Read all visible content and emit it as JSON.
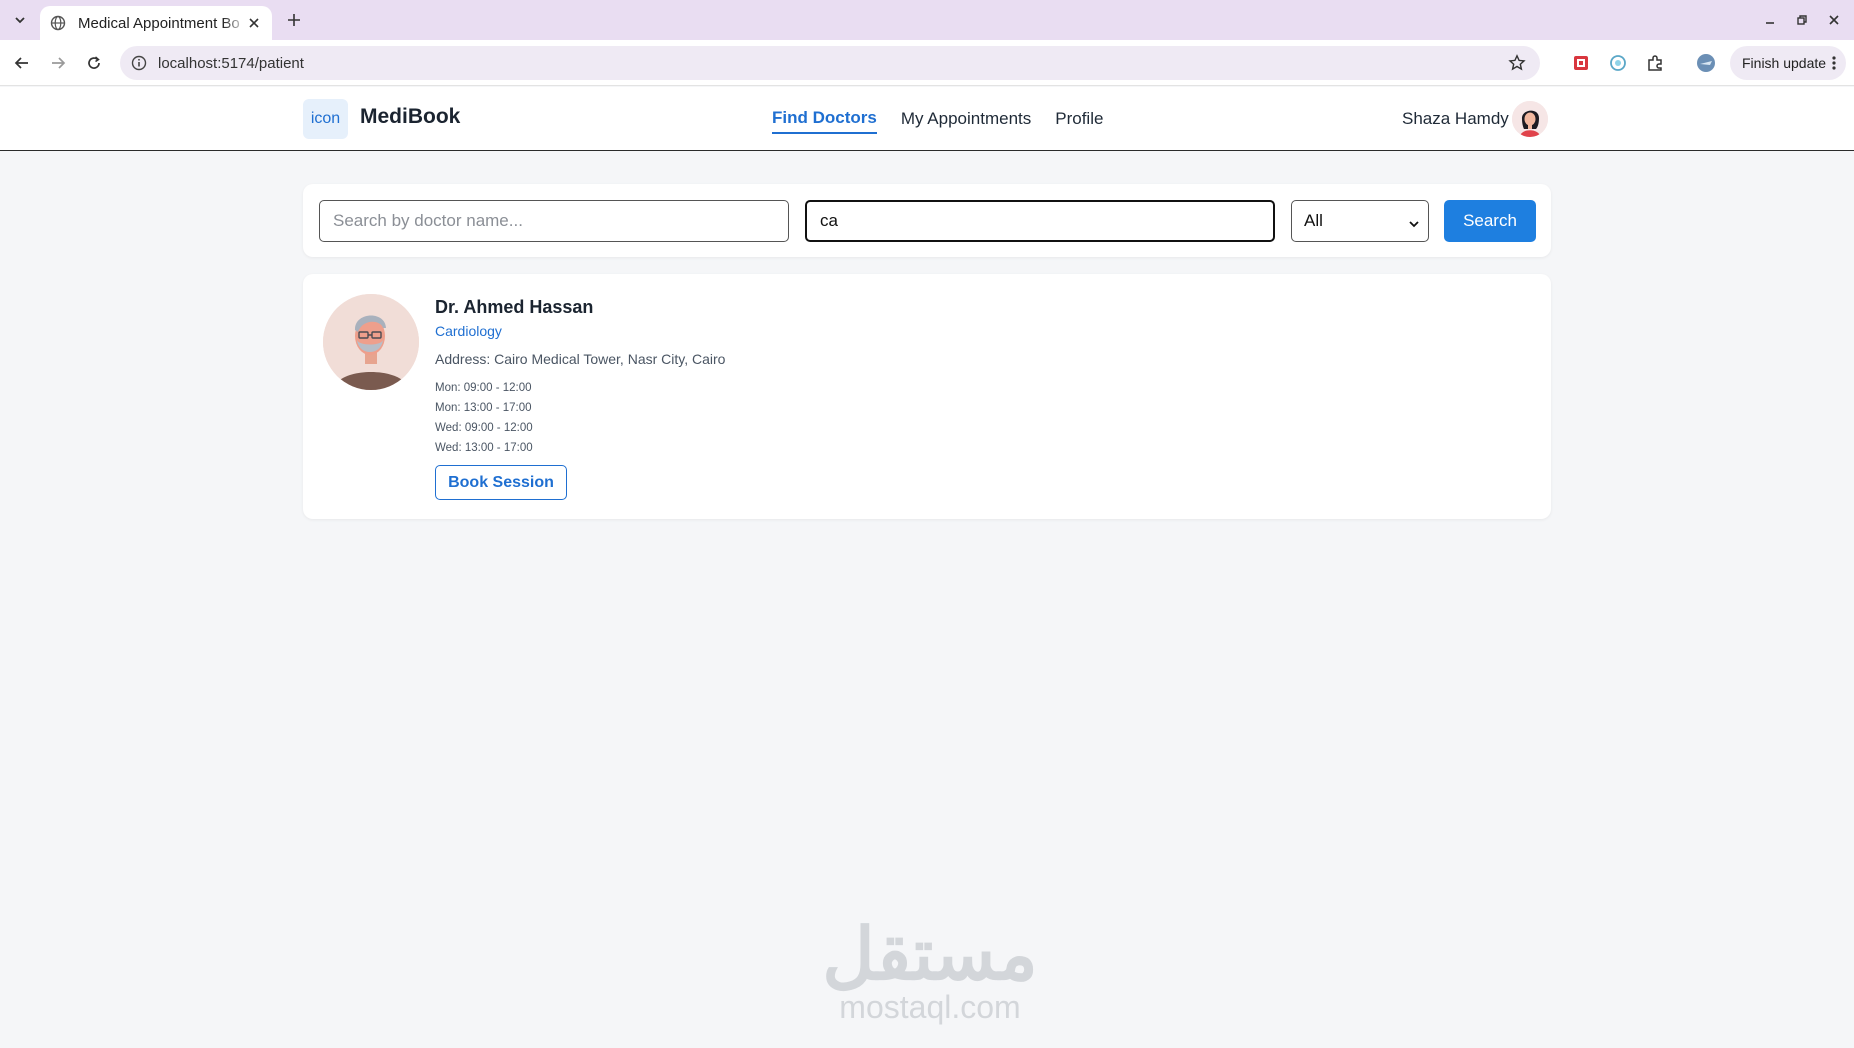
{
  "browser": {
    "tab_title": "Medical Appointment Bo",
    "url": "localhost:5174/patient",
    "finish_update_label": "Finish update"
  },
  "app": {
    "logo_text": "icon",
    "brand": "MediBook",
    "nav": [
      {
        "label": "Find Doctors",
        "active": true
      },
      {
        "label": "My Appointments",
        "active": false
      },
      {
        "label": "Profile",
        "active": false
      }
    ],
    "user_name": "Shaza Hamdy"
  },
  "search": {
    "name_placeholder": "Search by doctor name...",
    "name_value": "",
    "specialty_value": "ca",
    "filter_selected": "All",
    "search_label": "Search"
  },
  "doctors": [
    {
      "name": "Dr. Ahmed Hassan",
      "specialty": "Cardiology",
      "address": "Address: Cairo Medical Tower, Nasr City, Cairo",
      "slots": [
        "Mon: 09:00 - 12:00",
        "Mon: 13:00 - 17:00",
        "Wed: 09:00 - 12:00",
        "Wed: 13:00 - 17:00"
      ],
      "book_label": "Book Session"
    }
  ],
  "watermark": {
    "arabic": "مستقل",
    "latin": "mostaql.com"
  },
  "colors": {
    "accent": "#1e7fe0",
    "link": "#1f6fd1",
    "background": "#f5f6f8",
    "tabstrip": "#e9ddf2"
  }
}
